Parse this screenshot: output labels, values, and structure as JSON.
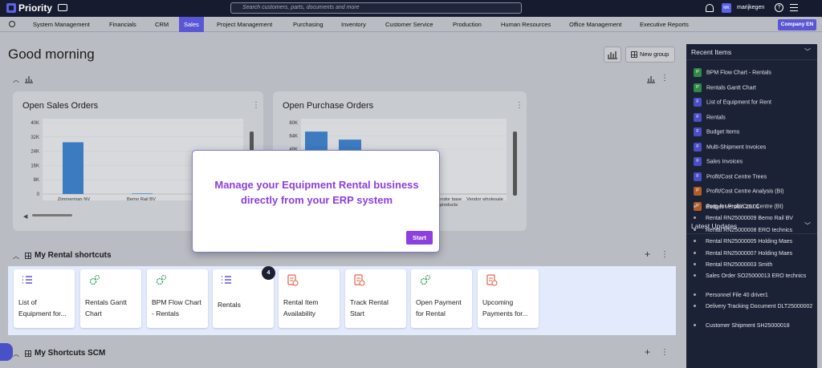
{
  "app": {
    "logo": "Priority",
    "search_placeholder": "Search customers, parts, documents and more",
    "username": "marijkegen",
    "avatar_text": "MK",
    "help": "?"
  },
  "menu": {
    "items": [
      "System Management",
      "Financials",
      "CRM",
      "Sales",
      "Project Management",
      "Purchasing",
      "Inventory",
      "Customer Service",
      "Production",
      "Human Resources",
      "Office Management",
      "Executive Reports"
    ],
    "active": "Sales",
    "company": "Company EN"
  },
  "greeting": "Good morning",
  "toolbar": {
    "new_group": "New group"
  },
  "charts_section": {
    "cards": [
      {
        "title": "Open Sales Orders"
      },
      {
        "title": "Open Purchase Orders"
      }
    ]
  },
  "chart_data": [
    {
      "type": "bar",
      "title": "Open Sales Orders",
      "categories": [
        "Zimmerman NV",
        "Bemo Rail BV"
      ],
      "values": [
        29000,
        300
      ],
      "y_ticks": [
        "40K",
        "32K",
        "24K",
        "16K",
        "8K",
        "0"
      ],
      "ylim": [
        0,
        40000
      ]
    },
    {
      "type": "bar",
      "title": "Open Purchase Orders",
      "categories": [
        "",
        "",
        "Vendor base products",
        "Vendor wholesale"
      ],
      "values": [
        70000,
        61000,
        0,
        0
      ],
      "y_ticks": [
        "80K",
        "64K",
        "48K"
      ],
      "ylim": [
        0,
        80000
      ]
    }
  ],
  "modal": {
    "text_line1": "Manage your Equipment Rental business",
    "text_line2": "directly from your ERP system",
    "start": "Start"
  },
  "rental_section": {
    "title": "My Rental shortcuts",
    "badge": "4",
    "shortcuts": [
      {
        "l1": "List of",
        "l2": "Equipment for...",
        "icon": "list-icon"
      },
      {
        "l1": "Rentals Gantt",
        "l2": "Chart",
        "icon": "gears-icon"
      },
      {
        "l1": "BPM Flow Chart",
        "l2": "- Rentals",
        "icon": "gears-icon"
      },
      {
        "l1": "Rentals",
        "l2": "",
        "icon": "list-icon"
      },
      {
        "l1": "Rental Item",
        "l2": "Availability",
        "icon": "document-icon"
      },
      {
        "l1": "Track Rental",
        "l2": "Start",
        "icon": "document-icon"
      },
      {
        "l1": "Open Payment",
        "l2": "for Rental",
        "icon": "gears-icon"
      },
      {
        "l1": "Upcoming",
        "l2": "Payments for...",
        "icon": "document-icon"
      }
    ]
  },
  "scm_section": {
    "title": "My Shortcuts SCM"
  },
  "recent": {
    "title": "Recent Items",
    "items": [
      {
        "badge": "P",
        "color": "#2f8a4a",
        "label": "BPM Flow Chart - Rentals"
      },
      {
        "badge": "P",
        "color": "#2f8a4a",
        "label": "Rentals Gantt Chart"
      },
      {
        "badge": "F",
        "color": "#4b4fc7",
        "label": "List of Equipment for Rent"
      },
      {
        "badge": "F",
        "color": "#4b4fc7",
        "label": "Rentals"
      },
      {
        "badge": "F",
        "color": "#4b4fc7",
        "label": "Budget Items"
      },
      {
        "badge": "F",
        "color": "#4b4fc7",
        "label": "Multi-Shipment Invoices"
      },
      {
        "badge": "F",
        "color": "#4b4fc7",
        "label": "Sales Invoices"
      },
      {
        "badge": "F",
        "color": "#4b4fc7",
        "label": "Profit/Cost Centre Trees"
      },
      {
        "badge": "P",
        "color": "#b25c2a",
        "label": "Profit/Cost Centre Analysis (BI)"
      },
      {
        "badge": "P",
        "color": "#b25c2a",
        "label": "Prep for Profit/Cost Centre (BI)"
      }
    ]
  },
  "updates": {
    "title": "Latest Updates",
    "items": [
      "Budget Version 25.01",
      "Rental RN25000009 Bemo Rail BV",
      "Rental RN25000008 ERO technics",
      "Rental RN25000005 Holding Maes",
      "Rental RN25000007 Holding Maes",
      "Rental RN25000003 Smith",
      "Sales Order SO25000013 ERO technics",
      "Personnel File 40 driver1",
      "Delivery Tracking Document DLT25000002",
      "Customer Shipment SH25000018"
    ]
  }
}
